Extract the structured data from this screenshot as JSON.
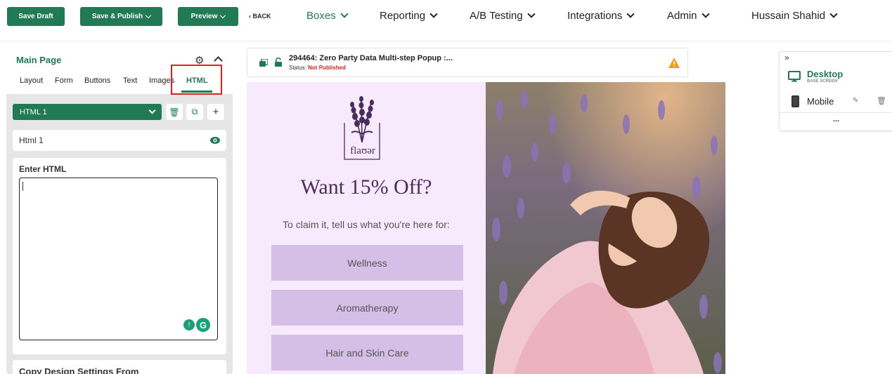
{
  "toolbar": {
    "save_draft": "Save Draft",
    "save_publish": "Save & Publish",
    "preview": "Preview",
    "back": "‹ BACK"
  },
  "nav": {
    "boxes": "Boxes",
    "reporting": "Reporting",
    "ab_testing": "A/B Testing",
    "integrations": "Integrations",
    "admin": "Admin",
    "user": "Hussain Shahid"
  },
  "left_panel": {
    "title": "Main Page",
    "tabs": [
      "Layout",
      "Form",
      "Buttons",
      "Text",
      "Images",
      "HTML"
    ],
    "active_tab": "HTML",
    "html_select": "HTML 1",
    "element_name": "Html 1",
    "editor_label": "Enter HTML",
    "editor_value": "",
    "copy_settings_label": "Copy Design Settings From"
  },
  "status_bar": {
    "title": "294464: Zero Party Data Multi-step Popup :...",
    "status_prefix": "Status:",
    "status_value": "Not Published"
  },
  "popup": {
    "logo_text": "flaʊər",
    "headline": "Want 15% Off?",
    "subhead": "To claim it, tell us what you're here for:",
    "options": [
      "Wellness",
      "Aromatherapy",
      "Hair and Skin Care"
    ]
  },
  "device_panel": {
    "desktop_label": "Desktop",
    "desktop_sub": "BASE SCREEN",
    "mobile_label": "Mobile",
    "more": "..."
  },
  "colors": {
    "brand_green": "#1f7a55",
    "popup_bg": "#f6eafc",
    "option_bg": "#d6bfe6",
    "warning": "#f39c12",
    "highlight_red": "#e02020",
    "lavender_text": "#4a2d5e"
  }
}
